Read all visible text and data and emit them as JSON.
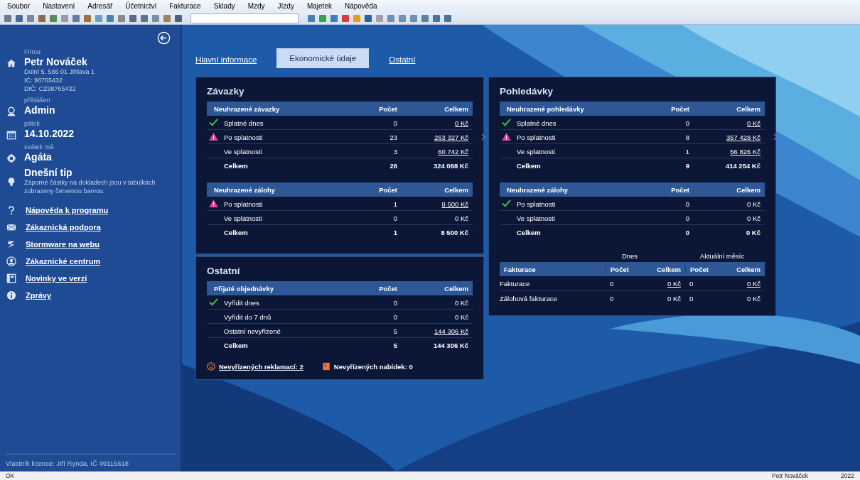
{
  "menu": [
    "Soubor",
    "Nastavení",
    "Adresář",
    "Účetnictví",
    "Fakturace",
    "Sklady",
    "Mzdy",
    "Jízdy",
    "Majetek",
    "Nápověda"
  ],
  "sidebar": {
    "sections": [
      {
        "kind": "company",
        "caption": "Firma",
        "title": "Petr Nováček",
        "lines": [
          "Dolní 5, 586 01 Jihlava 1",
          "IČ: 98765432",
          "DIČ: CZ98765432"
        ]
      },
      {
        "kind": "login",
        "caption": "přihlášen",
        "title": "Admin"
      },
      {
        "kind": "date",
        "caption": "pátek",
        "title": "14.10.2022"
      },
      {
        "kind": "nameday",
        "caption": "svátek má",
        "title": "Agáta"
      },
      {
        "kind": "tip",
        "title": "Dnešní tip",
        "lines": [
          "Záporné částky na dokladech jsou v tabulkách zobrazeny červenou barvou."
        ]
      }
    ],
    "links": [
      {
        "kind": "help",
        "label": "Nápověda k programu"
      },
      {
        "kind": "support",
        "label": "Zákaznická podpora"
      },
      {
        "kind": "web",
        "label": "Stormware na webu"
      },
      {
        "kind": "center",
        "label": "Zákaznické centrum"
      },
      {
        "kind": "news",
        "label": "Novinky ve verzi"
      },
      {
        "kind": "messages",
        "label": "Zprávy"
      }
    ],
    "license": "Vlastník licence: Jiří Rynda, IČ 49115618"
  },
  "tabs": [
    {
      "label": "Hlavní informace",
      "selected": false
    },
    {
      "label": "Ekonomické údaje",
      "selected": true
    },
    {
      "label": "Ostatní",
      "selected": false
    }
  ],
  "zavazky": {
    "title": "Závazky",
    "tables": [
      {
        "columns": [
          "Neuhrazené závazky",
          "Počet",
          "Celkem"
        ],
        "rows": [
          {
            "kind": "ok",
            "label": "Splatné dnes",
            "count": "0",
            "total": "0 Kč",
            "link": true,
            "total_row": false,
            "detail": false
          },
          {
            "kind": "warn",
            "label": "Po splatnosti",
            "count": "23",
            "total": "263 327 Kč",
            "link": true,
            "total_row": false,
            "detail": true
          },
          {
            "kind": "plain",
            "label": "Ve splatnosti",
            "count": "3",
            "total": "60 742 Kč",
            "link": true,
            "total_row": false,
            "detail": false
          },
          {
            "kind": "plain",
            "label": "Celkem",
            "count": "26",
            "total": "324 068 Kč",
            "link": false,
            "total_row": true,
            "detail": false
          }
        ]
      },
      {
        "columns": [
          "Neuhrazené zálohy",
          "Počet",
          "Celkem"
        ],
        "rows": [
          {
            "kind": "warn",
            "label": "Po splatnosti",
            "count": "1",
            "total": "8 500 Kč",
            "link": true,
            "total_row": false,
            "detail": false
          },
          {
            "kind": "plain",
            "label": "Ve splatnosti",
            "count": "0",
            "total": "0 Kč",
            "link": false,
            "total_row": false,
            "detail": false
          },
          {
            "kind": "plain",
            "label": "Celkem",
            "count": "1",
            "total": "8 500 Kč",
            "link": false,
            "total_row": true,
            "detail": false
          }
        ]
      }
    ]
  },
  "ostatni": {
    "title": "Ostatní",
    "tables": [
      {
        "columns": [
          "Přijaté objednávky",
          "Počet",
          "Celkem"
        ],
        "rows": [
          {
            "kind": "ok",
            "label": "Vyřídit dnes",
            "count": "0",
            "total": "0 Kč",
            "link": false,
            "total_row": false,
            "detail": false
          },
          {
            "kind": "plain",
            "label": "Vyřídit do 7 dnů",
            "count": "0",
            "total": "0 Kč",
            "link": false,
            "total_row": false,
            "detail": false
          },
          {
            "kind": "plain",
            "label": "Ostatní nevyřízené",
            "count": "5",
            "total": "144 306 Kč",
            "link": true,
            "total_row": false,
            "detail": false
          },
          {
            "kind": "plain",
            "label": "Celkem",
            "count": "5",
            "total": "144 306 Kč",
            "link": false,
            "total_row": true,
            "detail": false
          }
        ]
      }
    ],
    "footer": [
      {
        "kind": "complaints",
        "label": "Nevyřízených reklamací: 2",
        "link": true
      },
      {
        "kind": "offers",
        "label": "Nevyřízených nabídek: 0",
        "link": false
      }
    ]
  },
  "pohledavky": {
    "title": "Pohledávky",
    "tables": [
      {
        "columns": [
          "Neuhrazené pohledávky",
          "Počet",
          "Celkem"
        ],
        "rows": [
          {
            "kind": "ok",
            "label": "Splatné dnes",
            "count": "0",
            "total": "0 Kč",
            "link": true,
            "total_row": false,
            "detail": false
          },
          {
            "kind": "warn",
            "label": "Po splatnosti",
            "count": "8",
            "total": "357 428 Kč",
            "link": true,
            "total_row": false,
            "detail": true
          },
          {
            "kind": "plain",
            "label": "Ve splatnosti",
            "count": "1",
            "total": "56 826 Kč",
            "link": true,
            "total_row": false,
            "detail": false
          },
          {
            "kind": "plain",
            "label": "Celkem",
            "count": "9",
            "total": "414 254 Kč",
            "link": false,
            "total_row": true,
            "detail": false
          }
        ]
      },
      {
        "columns": [
          "Neuhrazené zálohy",
          "Počet",
          "Celkem"
        ],
        "rows": [
          {
            "kind": "ok",
            "label": "Po splatnosti",
            "count": "0",
            "total": "0 Kč",
            "link": false,
            "total_row": false,
            "detail": false
          },
          {
            "kind": "plain",
            "label": "Ve splatnosti",
            "count": "0",
            "total": "0 Kč",
            "link": false,
            "total_row": false,
            "detail": false
          },
          {
            "kind": "plain",
            "label": "Celkem",
            "count": "0",
            "total": "0 Kč",
            "link": false,
            "total_row": true,
            "detail": false
          }
        ]
      }
    ],
    "fakturace": {
      "groups": [
        "Dnes",
        "Aktuální měsíc"
      ],
      "columns": [
        "Fakturace",
        "Počet",
        "Celkem",
        "Počet",
        "Celkem"
      ],
      "rows": [
        {
          "cells": [
            {
              "text": "Fakturace",
              "link": false
            },
            {
              "text": "0",
              "link": false
            },
            {
              "text": "0 Kč",
              "link": true
            },
            {
              "text": "0",
              "link": false
            },
            {
              "text": "0 Kč",
              "link": true
            }
          ]
        },
        {
          "cells": [
            {
              "text": "Zálohová fakturace",
              "link": false
            },
            {
              "text": "0",
              "link": false
            },
            {
              "text": "0 Kč",
              "link": false
            },
            {
              "text": "0",
              "link": false
            },
            {
              "text": "0 Kč",
              "link": false
            }
          ]
        }
      ]
    }
  },
  "status_bar": {
    "left": "OK",
    "user": "Petr Nováček",
    "year": "2022"
  }
}
